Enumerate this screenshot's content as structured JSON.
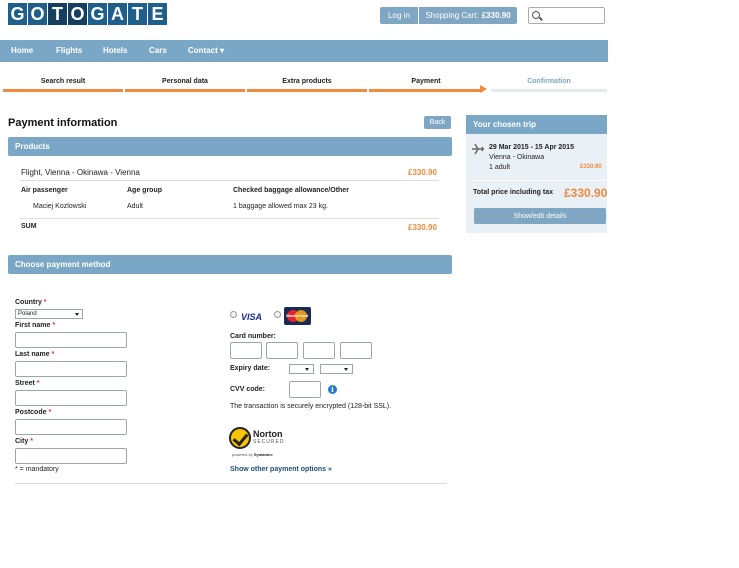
{
  "header": {
    "logo_letters": [
      "G",
      "O",
      "T",
      "O",
      "G",
      "A",
      "T",
      "E"
    ],
    "login_label": "Log in",
    "cart_label": "Shopping Cart:",
    "cart_total": "£330.90",
    "search_placeholder": ""
  },
  "nav": {
    "items": [
      "Home",
      "Flights",
      "Hotels",
      "Cars",
      "Contact ▾"
    ]
  },
  "steps": [
    {
      "label": "Search result",
      "active": true
    },
    {
      "label": "Personal data",
      "active": true
    },
    {
      "label": "Extra products",
      "active": true
    },
    {
      "label": "Payment",
      "active": true,
      "current": true
    },
    {
      "label": "Confirmation",
      "active": false
    }
  ],
  "main": {
    "title": "Payment information",
    "back_label": "Back",
    "products": {
      "heading": "Products",
      "flight_label": "Flight, Vienna - Okinawa - Vienna",
      "flight_price": "£330.90",
      "columns": [
        "Air passenger",
        "Age group",
        "Checked baggage allowance/Other"
      ],
      "rows": [
        [
          "Maciej Kozlowski",
          "Adult",
          "1 baggage allowed max 23 kg."
        ]
      ],
      "sum_label": "SUM",
      "sum_price": "£330.90"
    },
    "payment": {
      "heading": "Choose payment method",
      "country_label": "Country",
      "country_value": "Poland",
      "first_name_label": "First name",
      "last_name_label": "Last name",
      "street_label": "Street",
      "postcode_label": "Postcode",
      "city_label": "City",
      "required_marker": "*",
      "mandatory_note": "* = mandatory",
      "visa_label": "VISA",
      "mastercard_label": "MasterCard",
      "card_number_label": "Card number:",
      "expiry_label": "Expiry date:",
      "cvv_label": "CVV code:",
      "info_glyph": "i",
      "ssl_note": "The transaction is securely encrypted (128-bit SSL).",
      "norton_title": "Norton",
      "norton_sub": "SECURED",
      "norton_powered": "powered by",
      "norton_brand": "Symantec",
      "other_options_link": "Show other payment options »"
    }
  },
  "sidebar": {
    "heading": "Your chosen trip",
    "dates": "29 Mar 2015 - 15 Apr 2015",
    "route": "Vienna - Okinawa",
    "travellers": "1 adult",
    "trip_price": "£330.90",
    "total_label": "Total price including tax",
    "total_price": "£330.90",
    "details_button": "Show/edit details"
  },
  "colors": {
    "brand": "#1f5f8b",
    "bar": "#7ba7c7",
    "accent": "#f08a3c"
  }
}
